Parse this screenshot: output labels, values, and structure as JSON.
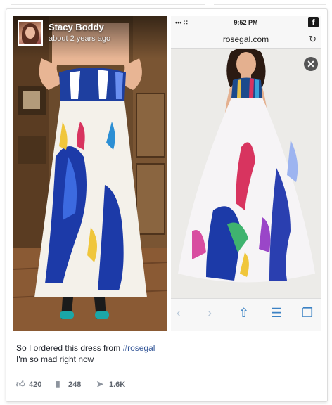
{
  "post": {
    "poster_name": "Stacy Boddy",
    "timestamp": "about 2 years ago",
    "caption_line1_prefix": "So I ordered this dress from ",
    "hashtag": "#rosegal",
    "caption_line2": "I'm so mad right now"
  },
  "phone": {
    "status_left": "••• ∷",
    "clock": "9:52 PM",
    "fb_badge": "f",
    "url": "rosegal.com",
    "reload_icon": "↻",
    "close_icon": "✕",
    "toolbar": {
      "back": "‹",
      "forward": "›",
      "share": "⇧",
      "bookmarks": "☰",
      "tabs": "❐"
    }
  },
  "stats": {
    "likes": "420",
    "comments": "248",
    "shares": "1.6K",
    "like_icon": "thumbs-up-icon",
    "comment_icon": "comment-icon",
    "share_icon": "share-arrow-icon"
  },
  "colors": {
    "hashtag": "#365899",
    "text": "#1d2129",
    "muted": "#616770",
    "ios_blue": "#3b82c4"
  }
}
